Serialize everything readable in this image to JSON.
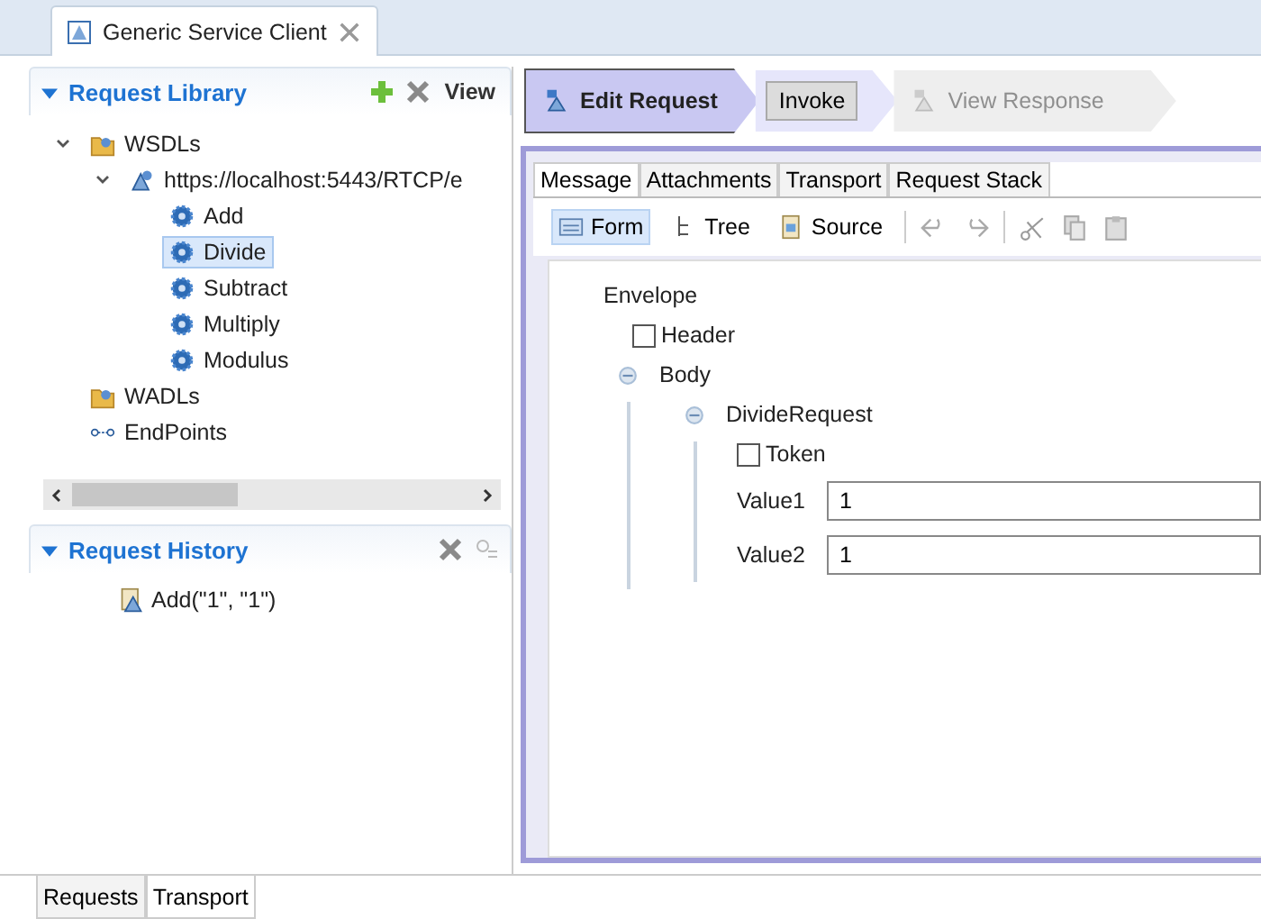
{
  "editor_tab": {
    "title": "Generic Service Client"
  },
  "request_library": {
    "title": "Request Library",
    "view_label": "View",
    "tree": [
      {
        "label": "WSDLs",
        "kind": "folder",
        "expanded": true,
        "selected": false,
        "children": [
          {
            "label": "https://localhost:5443/RTCP/e",
            "kind": "service",
            "expanded": true,
            "selected": false,
            "children": [
              {
                "label": "Add",
                "kind": "operation",
                "selected": false
              },
              {
                "label": "Divide",
                "kind": "operation",
                "selected": true
              },
              {
                "label": "Subtract",
                "kind": "operation",
                "selected": false
              },
              {
                "label": "Multiply",
                "kind": "operation",
                "selected": false
              },
              {
                "label": "Modulus",
                "kind": "operation",
                "selected": false
              }
            ]
          }
        ]
      },
      {
        "label": "WADLs",
        "kind": "folder",
        "selected": false
      },
      {
        "label": "EndPoints",
        "kind": "endpoint",
        "selected": false
      }
    ]
  },
  "request_history": {
    "title": "Request History",
    "items": [
      {
        "label": "Add(\"1\", \"1\")"
      }
    ]
  },
  "steps": [
    {
      "label": "Edit Request",
      "kind": "active"
    },
    {
      "label": "Invoke",
      "kind": "button"
    },
    {
      "label": "View Response",
      "kind": "disabled"
    }
  ],
  "message_tabs": [
    {
      "label": "Message",
      "selected": true
    },
    {
      "label": "Attachments",
      "selected": false
    },
    {
      "label": "Transport",
      "selected": false
    },
    {
      "label": "Request Stack",
      "selected": false
    }
  ],
  "view_modes": [
    {
      "label": "Form",
      "kind": "form",
      "selected": true
    },
    {
      "label": "Tree",
      "kind": "tree",
      "selected": false
    },
    {
      "label": "Source",
      "kind": "source",
      "selected": false
    }
  ],
  "form": {
    "root": "Envelope",
    "header": {
      "label": "Header",
      "checked": false
    },
    "body": {
      "label": "Body",
      "expanded": true
    },
    "request": {
      "label": "DivideRequest",
      "expanded": true
    },
    "token": {
      "label": "Token",
      "checked": false
    },
    "fields": [
      {
        "label": "Value1",
        "value": "1"
      },
      {
        "label": "Value2",
        "value": "1"
      }
    ]
  },
  "bottom_tabs": [
    {
      "label": "Requests",
      "selected": false
    },
    {
      "label": "Transport",
      "selected": true
    }
  ]
}
